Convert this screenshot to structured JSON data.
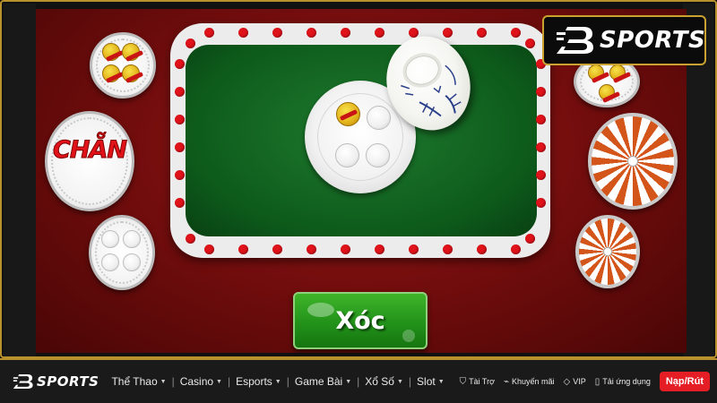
{
  "brand": {
    "name": "SPORTS"
  },
  "game": {
    "bet_even_label": "CHẴN",
    "shake_button_label": "Xóc"
  },
  "nav": {
    "items": [
      {
        "label": "Thể Thao",
        "dropdown": true
      },
      {
        "label": "Casino",
        "dropdown": true
      },
      {
        "label": "Esports",
        "dropdown": true
      },
      {
        "label": "Game Bài",
        "dropdown": true
      },
      {
        "label": "Xổ Số",
        "dropdown": true
      },
      {
        "label": "Slot",
        "dropdown": true
      }
    ],
    "links": [
      {
        "label": "Tài Trợ",
        "icon": "shield-icon"
      },
      {
        "label": "Khuyến mãi",
        "icon": "tag-icon"
      },
      {
        "label": "VIP",
        "icon": "diamond-icon"
      },
      {
        "label": "Tải ứng dụng",
        "icon": "phone-icon"
      }
    ],
    "deposit_label": "Nạp/Rút"
  },
  "colors": {
    "accent_gold": "#b8912c",
    "felt_green": "#0d5a1b",
    "background_red": "#7a0e0e",
    "deposit_red": "#e51e25"
  }
}
